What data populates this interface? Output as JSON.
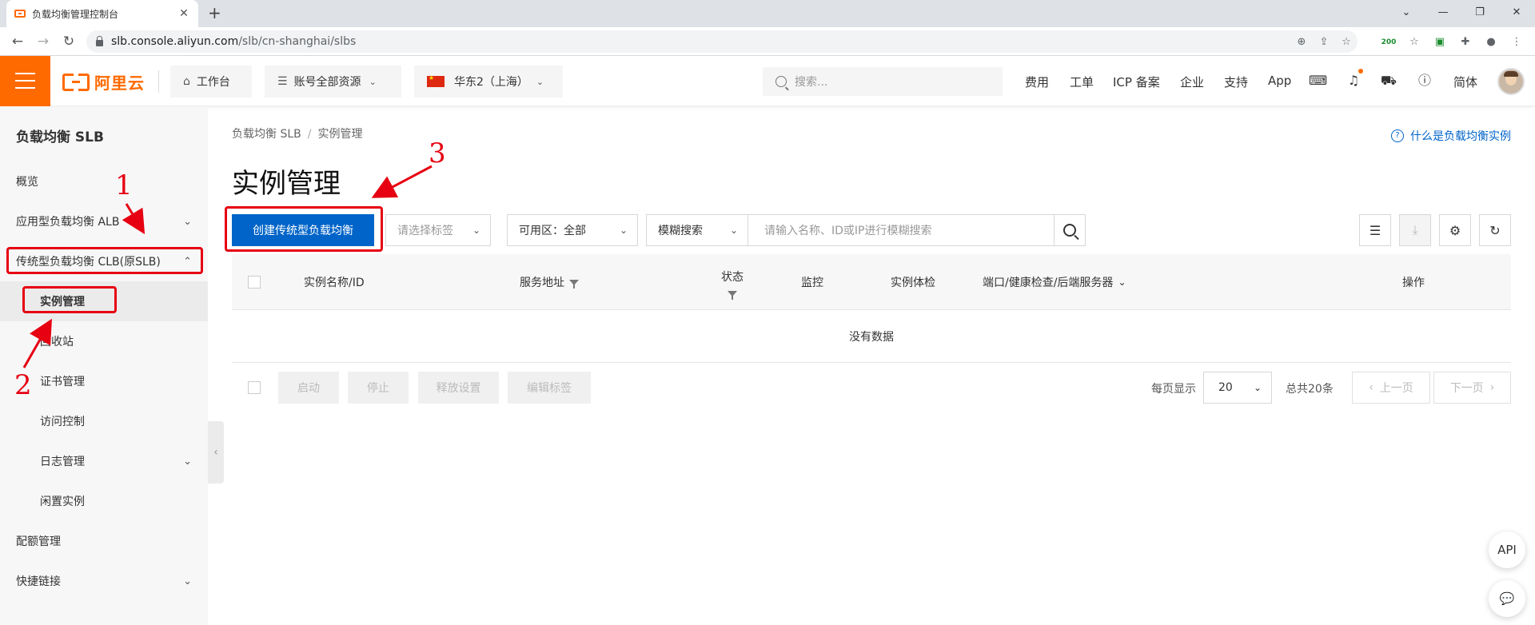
{
  "browser": {
    "tab_title": "负载均衡管理控制台",
    "tab_close": "✕",
    "new_tab": "+",
    "url_host": "slb.console.aliyun.com",
    "url_path": "/slb/cn-shanghai/slbs",
    "ext_counter": "200"
  },
  "header": {
    "logo_text": "阿里云",
    "workbench": "工作台",
    "resources": "账号全部资源",
    "region": "华东2（上海）",
    "search_placeholder": "搜索...",
    "nav": [
      "费用",
      "工单",
      "ICP 备案",
      "企业",
      "支持",
      "App"
    ],
    "lang": "简体"
  },
  "sidebar": {
    "title": "负载均衡 SLB",
    "items": [
      {
        "label": "概览"
      },
      {
        "label": "应用型负载均衡 ALB"
      },
      {
        "label": "传统型负载均衡 CLB(原SLB)"
      },
      {
        "label": "实例管理"
      },
      {
        "label": "回收站"
      },
      {
        "label": "证书管理"
      },
      {
        "label": "访问控制"
      },
      {
        "label": "日志管理"
      },
      {
        "label": "闲置实例"
      },
      {
        "label": "配额管理"
      },
      {
        "label": "快捷链接"
      }
    ]
  },
  "main": {
    "breadcrumb": [
      "负载均衡 SLB",
      "实例管理"
    ],
    "breadcrumb_sep": "/",
    "help_link": "什么是负载均衡实例",
    "page_title": "实例管理",
    "create_button": "创建传统型负载均衡",
    "tag_select_placeholder": "请选择标签",
    "zone_select": "可用区：全部",
    "search_mode": "模糊搜索",
    "keyword_placeholder": "请输入名称、ID或IP进行模糊搜索",
    "table": {
      "columns": [
        "实例名称/ID",
        "服务地址",
        "状态",
        "监控",
        "实例体检",
        "端口/健康检查/后端服务器",
        "操作"
      ],
      "empty_text": "没有数据"
    },
    "batch_buttons": [
      "启动",
      "停止",
      "释放设置",
      "编辑标签"
    ],
    "page_size_label": "每页显示",
    "page_size": "20",
    "total_text": "总共20条",
    "prev_page": "上一页",
    "next_page": "下一页"
  },
  "annotations": {
    "step1": "1",
    "step2": "2",
    "step3": "3",
    "color": "#e60012"
  },
  "floating": {
    "api_label": "API"
  },
  "colors": {
    "brand_orange": "#ff6a00",
    "primary_blue": "#0064c8"
  }
}
